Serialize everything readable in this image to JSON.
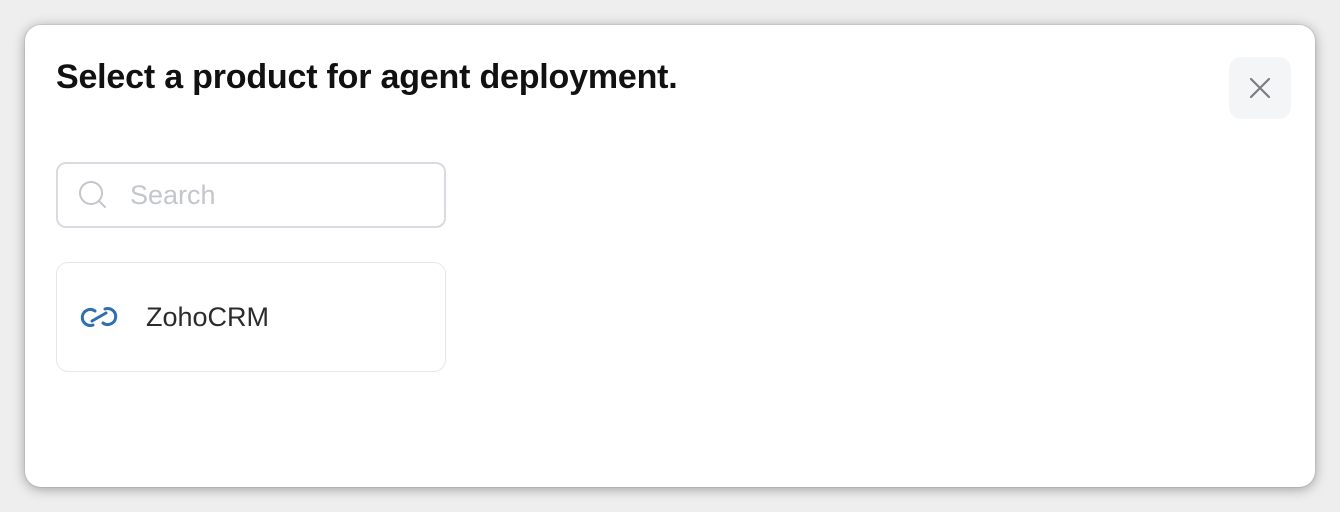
{
  "dialog": {
    "title": "Select a product for agent deployment.",
    "close_icon": "close-icon"
  },
  "search": {
    "placeholder": "Search",
    "value": "",
    "icon": "search-icon"
  },
  "products": [
    {
      "label": "ZohoCRM",
      "icon": "zoho-crm-logo-icon",
      "icon_color": "#2f6fb0"
    }
  ],
  "colors": {
    "title": "#111111",
    "close_button_bg": "#f4f5f7",
    "input_border": "#d9dbe0",
    "placeholder": "#c3c6cc",
    "card_border": "#e6e7ea"
  }
}
